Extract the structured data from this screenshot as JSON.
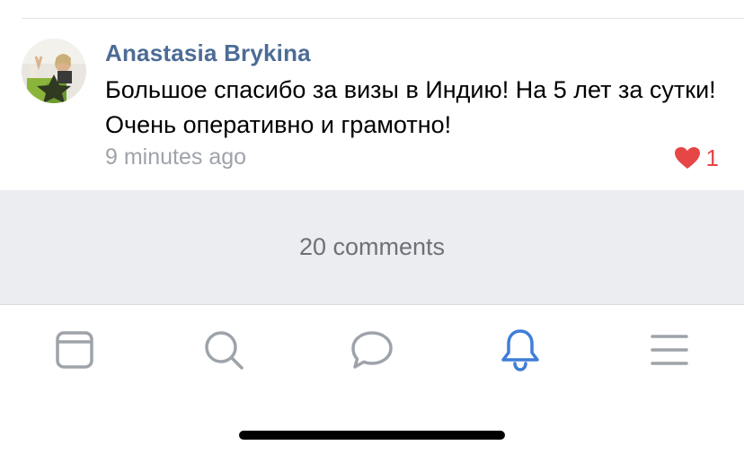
{
  "comment": {
    "author": "Anastasia Brykina",
    "text": "Большое спасибо за визы в Индию! На 5 лет за сутки! Очень оперативно и грамотно!",
    "time": "9 minutes ago",
    "likes": "1",
    "avatar_icon": "user-photo",
    "like_icon": "heart-icon",
    "like_color": "#e64646",
    "author_color": "#4c6c96"
  },
  "comments_footer": {
    "label": "20 comments"
  },
  "tabbar": {
    "active_color": "#3f7ed8",
    "inactive_color": "#9ea3aa",
    "items": [
      {
        "icon": "feed-icon",
        "active": false
      },
      {
        "icon": "search-icon",
        "active": false
      },
      {
        "icon": "messages-icon",
        "active": false
      },
      {
        "icon": "notifications-bell-icon",
        "active": true
      },
      {
        "icon": "menu-icon",
        "active": false
      }
    ]
  }
}
